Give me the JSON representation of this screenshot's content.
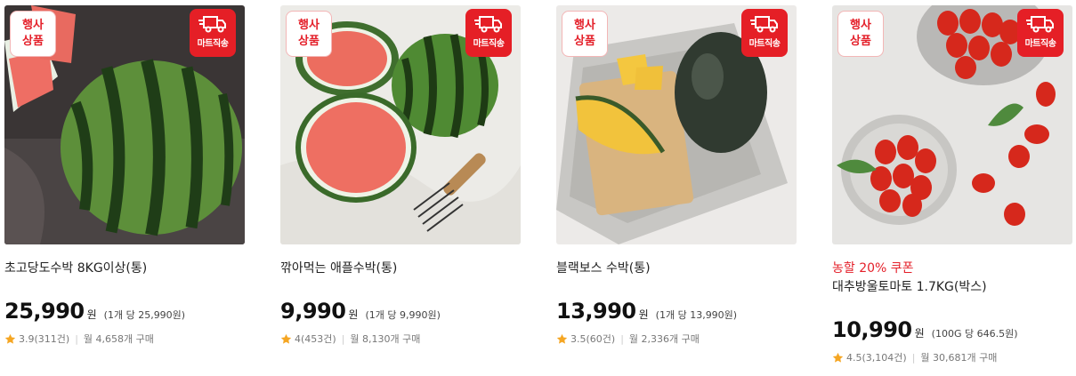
{
  "products": [
    {
      "event_badge": [
        "행사",
        "상품"
      ],
      "delivery_badge": "마트직송",
      "coupon": "",
      "name": "초고당도수박 8KG이상(통)",
      "price": "25,990",
      "currency": "원",
      "unit_price": "(1개 당 25,990원)",
      "rating": "3.9(311건)",
      "purchases": "월 4,658개 구매",
      "image": "watermelon-whole"
    },
    {
      "event_badge": [
        "행사",
        "상품"
      ],
      "delivery_badge": "마트직송",
      "coupon": "",
      "name": "깎아먹는 애플수박(통)",
      "price": "9,990",
      "currency": "원",
      "unit_price": "(1개 당 9,990원)",
      "rating": "4(453건)",
      "purchases": "월 8,130개 구매",
      "image": "apple-watermelon"
    },
    {
      "event_badge": [
        "행사",
        "상품"
      ],
      "delivery_badge": "마트직송",
      "coupon": "",
      "name": "블랙보스 수박(통)",
      "price": "13,990",
      "currency": "원",
      "unit_price": "(1개 당 13,990원)",
      "rating": "3.5(60건)",
      "purchases": "월 2,336개 구매",
      "image": "black-watermelon"
    },
    {
      "event_badge": [
        "행사",
        "상품"
      ],
      "delivery_badge": "마트직송",
      "coupon": "농할 20% 쿠폰",
      "name": "대추방울토마토 1.7KG(박스)",
      "price": "10,990",
      "currency": "원",
      "unit_price": "(100G 당 646.5원)",
      "rating": "4.5(3,104건)",
      "purchases": "월 30,681개 구매",
      "image": "cherry-tomatoes"
    }
  ],
  "colors": {
    "accent_red": "#e51f26",
    "star": "#f5a623",
    "coupon_text": "#e4202a"
  }
}
